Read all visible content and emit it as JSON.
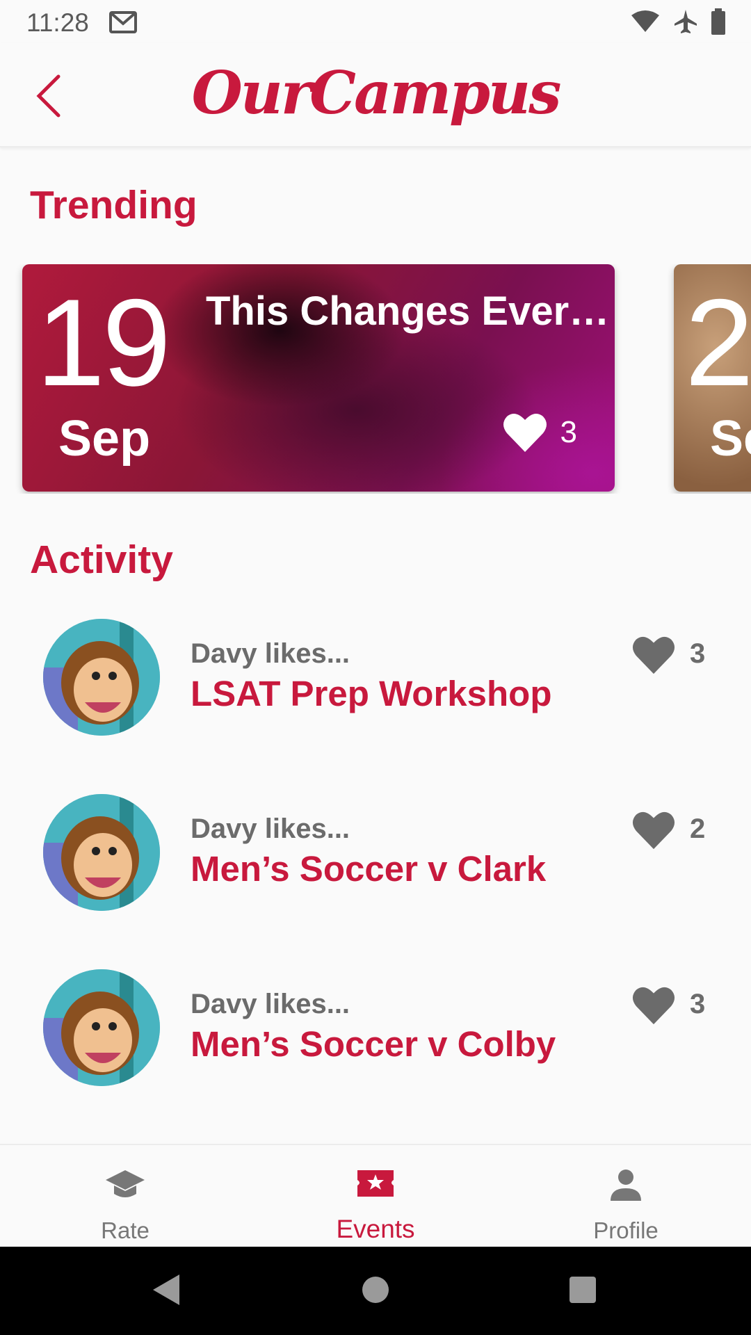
{
  "status_bar": {
    "time": "11:28"
  },
  "app_bar": {
    "logo_text": "OurCampus"
  },
  "sections": {
    "trending": "Trending",
    "activity": "Activity"
  },
  "trending": [
    {
      "day": "19",
      "month": "Sep",
      "title": "This Changes Ever…",
      "likes": "3"
    },
    {
      "day": "2",
      "month": "Se"
    }
  ],
  "activity": [
    {
      "user_text": "Davy likes...",
      "event": "LSAT Prep Workshop",
      "likes": "3"
    },
    {
      "user_text": "Davy likes...",
      "event": "Men’s Soccer v Clark",
      "likes": "2"
    },
    {
      "user_text": "Davy likes...",
      "event": "Men’s Soccer v Colby",
      "likes": "3"
    }
  ],
  "bottom_nav": [
    {
      "label": "Rate",
      "icon": "graduation-cap-icon",
      "active": false
    },
    {
      "label": "Events",
      "icon": "ticket-star-icon",
      "active": true
    },
    {
      "label": "Profile",
      "icon": "person-icon",
      "active": false
    }
  ],
  "colors": {
    "accent": "#c8193d",
    "muted": "#6b6b6b"
  }
}
